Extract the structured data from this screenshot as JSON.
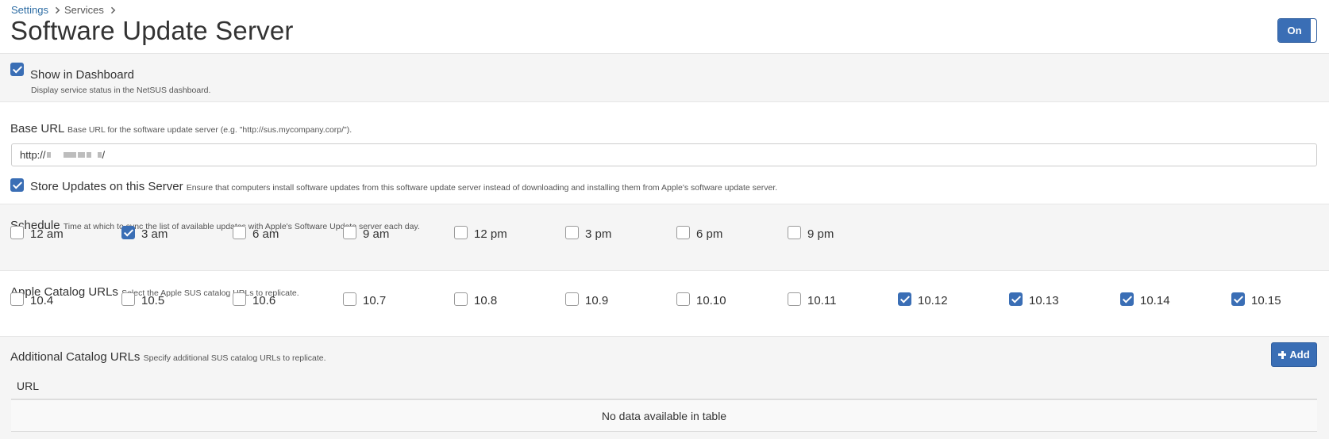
{
  "breadcrumb": {
    "root": "Settings",
    "services": "Services"
  },
  "page_title": "Software Update Server",
  "service_toggle": {
    "label": "On",
    "state": "on"
  },
  "show_in_dashboard": {
    "label": "Show in Dashboard",
    "help": "Display service status in the NetSUS dashboard.",
    "checked": true
  },
  "base_url": {
    "label": "Base URL",
    "help": "Base URL for the software update server (e.g. \"http://sus.mycompany.corp/\").",
    "value_prefix": "http://",
    "value_suffix": "/"
  },
  "store_updates": {
    "label": "Store Updates on this Server",
    "help": "Ensure that computers install software updates from this software update server instead of downloading and installing them from Apple's software update server.",
    "checked": true
  },
  "schedule": {
    "label": "Schedule",
    "help": "Time at which to sync the list of available updates with Apple's Software Update server each day.",
    "options": [
      {
        "label": "12 am",
        "checked": false
      },
      {
        "label": "3 am",
        "checked": true
      },
      {
        "label": "6 am",
        "checked": false
      },
      {
        "label": "9 am",
        "checked": false
      },
      {
        "label": "12 pm",
        "checked": false
      },
      {
        "label": "3 pm",
        "checked": false
      },
      {
        "label": "6 pm",
        "checked": false
      },
      {
        "label": "9 pm",
        "checked": false
      }
    ]
  },
  "apple_catalogs": {
    "label": "Apple Catalog URLs",
    "help": "Select the Apple SUS catalog URLs to replicate.",
    "options": [
      {
        "label": "10.4",
        "checked": false
      },
      {
        "label": "10.5",
        "checked": false
      },
      {
        "label": "10.6",
        "checked": false
      },
      {
        "label": "10.7",
        "checked": false
      },
      {
        "label": "10.8",
        "checked": false
      },
      {
        "label": "10.9",
        "checked": false
      },
      {
        "label": "10.10",
        "checked": false
      },
      {
        "label": "10.11",
        "checked": false
      },
      {
        "label": "10.12",
        "checked": true
      },
      {
        "label": "10.13",
        "checked": true
      },
      {
        "label": "10.14",
        "checked": true
      },
      {
        "label": "10.15",
        "checked": true
      }
    ]
  },
  "additional_catalogs": {
    "label": "Additional Catalog URLs",
    "help": "Specify additional SUS catalog URLs to replicate.",
    "add_button": "Add",
    "table": {
      "columns": [
        "URL"
      ],
      "empty_text": "No data available in table"
    }
  },
  "colors": {
    "accent": "#3a6eb5",
    "link": "#2e6da4",
    "section_gray": "#f5f5f5"
  },
  "icons": {
    "breadcrumb_separator": "chevron-right-icon",
    "add": "plus-icon",
    "check": "checkmark-icon"
  }
}
